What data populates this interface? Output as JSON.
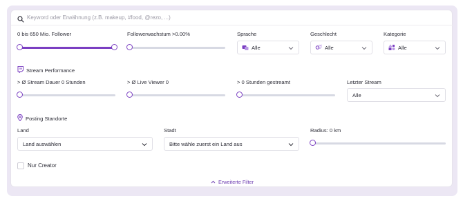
{
  "search": {
    "icon": "search-icon",
    "placeholder": "Keyword oder Erwähnung (z.B. makeup, #food, @rezo, ...)",
    "value": ""
  },
  "filters_row1": {
    "follower": {
      "label": "0 bis 650 Mio. Follower",
      "range_min_fraction": 0.0,
      "range_max_fraction": 1.0
    },
    "growth": {
      "label": "Followerwachstum >0.00%",
      "value_fraction": 0.0
    },
    "language": {
      "label": "Sprache",
      "value": "Alle",
      "icon": "language-icon"
    },
    "gender": {
      "label": "Geschlecht",
      "value": "Alle",
      "icon": "gender-icon"
    },
    "category": {
      "label": "Kategorie",
      "value": "Alle",
      "icon": "category-icon"
    }
  },
  "stream_performance": {
    "title": "Stream Performance",
    "icon": "twitch-icon",
    "duration": {
      "label": "> Ø Stream Dauer 0 Stunden",
      "value_fraction": 0.0
    },
    "viewers": {
      "label": "> Ø Live Viewer 0",
      "value_fraction": 0.0
    },
    "hours": {
      "label": "> 0 Stunden gestreamt",
      "value_fraction": 0.0
    },
    "last_stream": {
      "label": "Letzter Stream",
      "value": "Alle"
    }
  },
  "locations": {
    "title": "Posting Standorte",
    "icon": "map-pin-icon",
    "country": {
      "label": "Land",
      "value": "Land auswählen"
    },
    "city": {
      "label": "Stadt",
      "value": "Bitte wähle zuerst ein Land aus"
    },
    "radius": {
      "label": "Radius: 0 km",
      "value_fraction": 0.0
    }
  },
  "creator_only": {
    "label": "Nur Creator",
    "checked": false
  },
  "advanced": {
    "label": "Erweiterte Filter",
    "icon": "chevron-up-icon"
  },
  "colors": {
    "accent": "#7b3fc2",
    "track": "#d7d9e3",
    "frame": "#ece7f4"
  }
}
